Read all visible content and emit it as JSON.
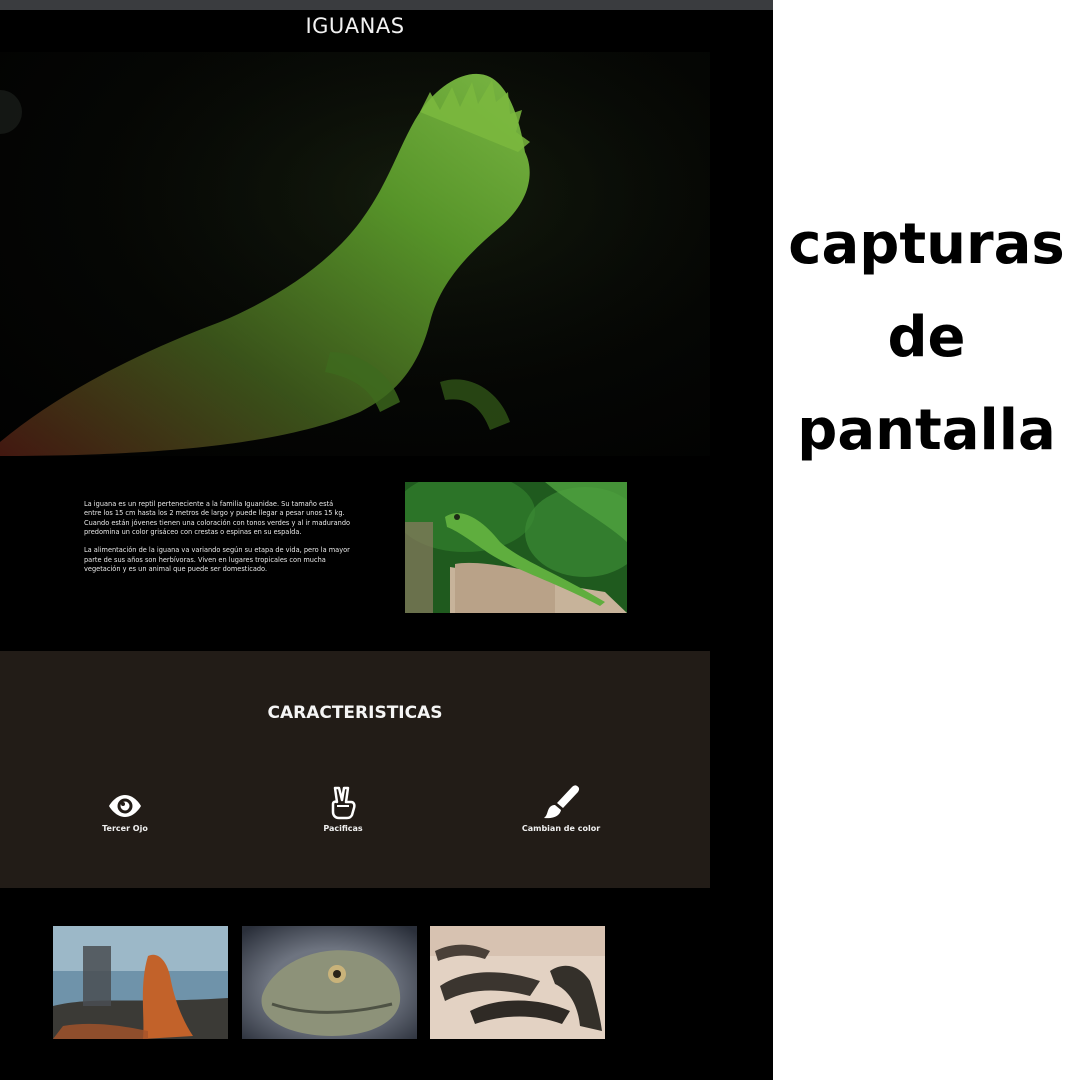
{
  "site": {
    "title": "IGUANAS",
    "intro_paragraphs": [
      "La iguana es un reptil perteneciente a la familia Iguanidae. Su tamaño está entre los 15 cm hasta los 2 metros de largo y puede llegar a pesar unos 15 kg. Cuando están jóvenes tienen una coloración con tonos verdes y al ir madurando predomina un color grisáceo con crestas o espinas en su espalda.",
      "La alimentación de la iguana va variando según su etapa de vida, pero la mayor parte de sus años son herbívoras. Viven en lugares tropicales con mucha vegetación y es un animal que puede ser domesticado."
    ],
    "features": {
      "title": "CARACTERISTICAS",
      "items": [
        {
          "label": "Tercer Ojo",
          "icon": "eye-icon"
        },
        {
          "label": "Pacificas",
          "icon": "peace-hand-icon"
        },
        {
          "label": "Cambian de color",
          "icon": "paint-brush-icon"
        }
      ]
    },
    "gallery": [
      {
        "icon": "iguana-on-rock-photo"
      },
      {
        "icon": "iguana-head-photo"
      },
      {
        "icon": "marine-iguanas-photo"
      }
    ]
  },
  "caption": {
    "lines": [
      "capturas",
      "de",
      "pantalla"
    ]
  },
  "colors": {
    "page_background": "#000000",
    "features_background": "#221c17",
    "caption_text": "#000000"
  }
}
